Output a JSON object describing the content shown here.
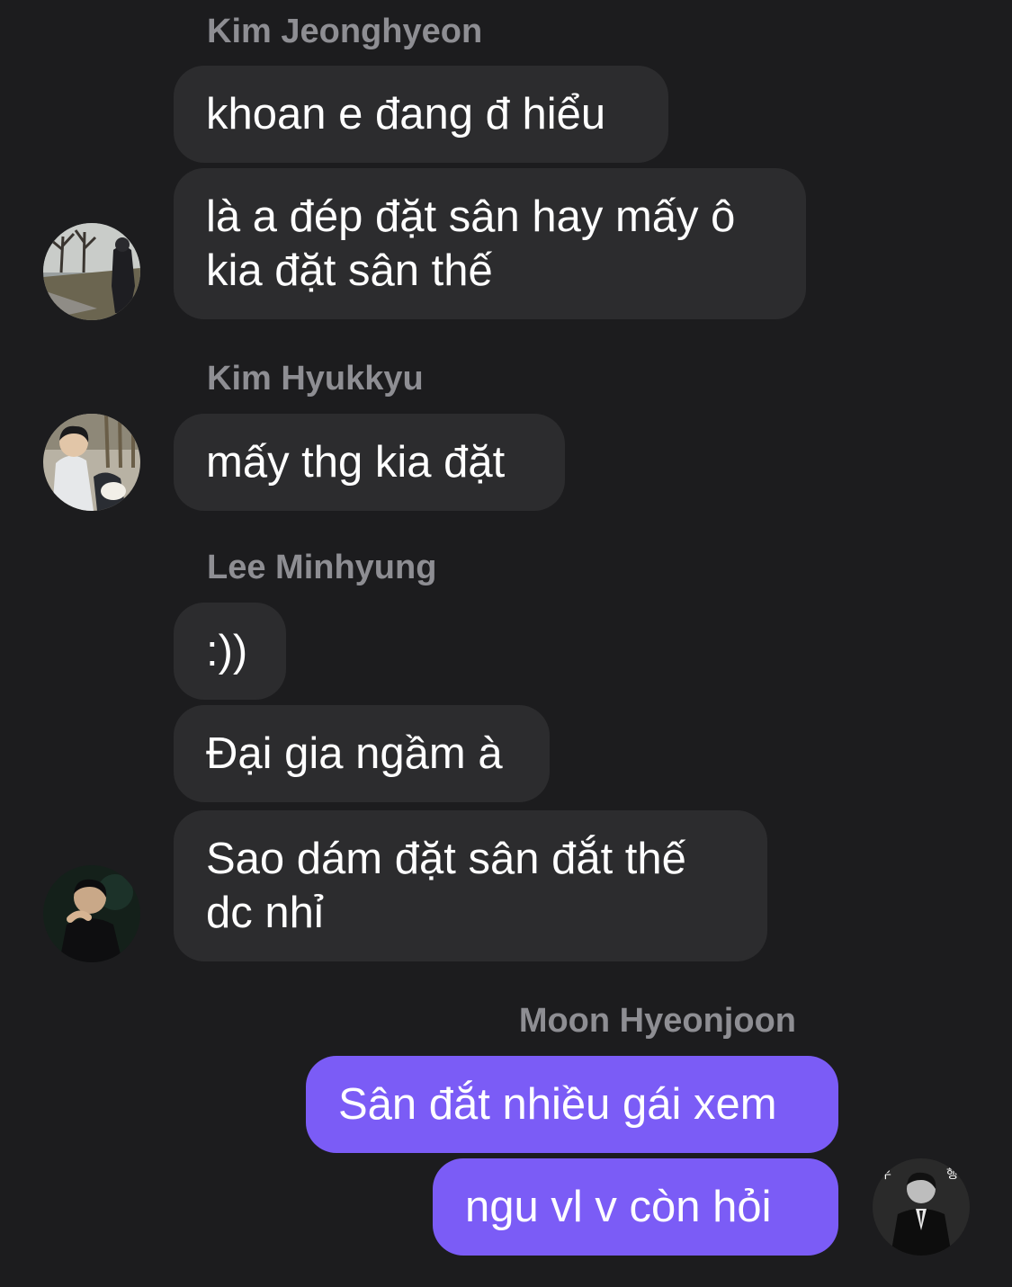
{
  "chat": {
    "groups": [
      {
        "sender": "Kim Jeonghyeon",
        "messages": [
          "khoan e đang đ hiểu",
          "là a đép đặt sân hay mấy ô\nkia đặt sân thế"
        ],
        "avatar": "photo-avatar-outdoor"
      },
      {
        "sender": "Kim Hyukkyu",
        "messages": [
          "mấy thg kia đặt"
        ],
        "avatar": "photo-avatar-person-with-dog"
      },
      {
        "sender": "Lee Minhyung",
        "messages": [
          ":))",
          "Đại gia ngầm à",
          "Sao dám đặt sân đắt thế\ndc nhỉ"
        ],
        "avatar": "photo-avatar-dark-portrait"
      },
      {
        "sender": "Moon Hyeonjoon",
        "outgoing": true,
        "messages": [
          "Sân đắt nhiều gái xem",
          "ngu vl v còn hỏi"
        ],
        "avatar": "photo-avatar-bw-suit"
      }
    ]
  },
  "colors": {
    "background": "#1c1c1e",
    "incoming_bubble": "#2c2c2e",
    "outgoing_bubble": "#7b5cf6",
    "sender_name": "#8e8e93"
  }
}
